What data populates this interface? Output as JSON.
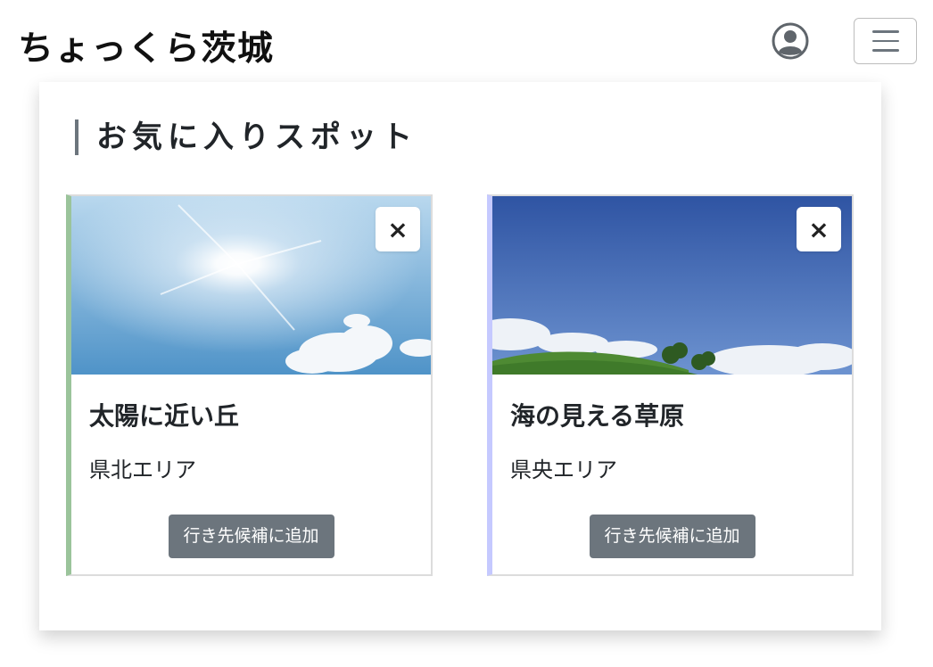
{
  "header": {
    "brand": "ちょっくら茨城",
    "user_icon": "user-circle-icon",
    "menu_icon": "hamburger-menu-icon"
  },
  "favorites": {
    "title": "お気に入りスポット",
    "cards": [
      {
        "title": "太陽に近い丘",
        "area": "県北エリア",
        "add_label": "行き先候補に追加",
        "close_label": "×",
        "accent": "#9bc49b",
        "image": "sun-sky-photo"
      },
      {
        "title": "海の見える草原",
        "area": "県央エリア",
        "add_label": "行き先候補に追加",
        "close_label": "×",
        "accent": "#c5c9ff",
        "image": "grassland-sky-photo"
      }
    ]
  },
  "colors": {
    "button_bg": "#6c757d",
    "text": "#212529"
  }
}
